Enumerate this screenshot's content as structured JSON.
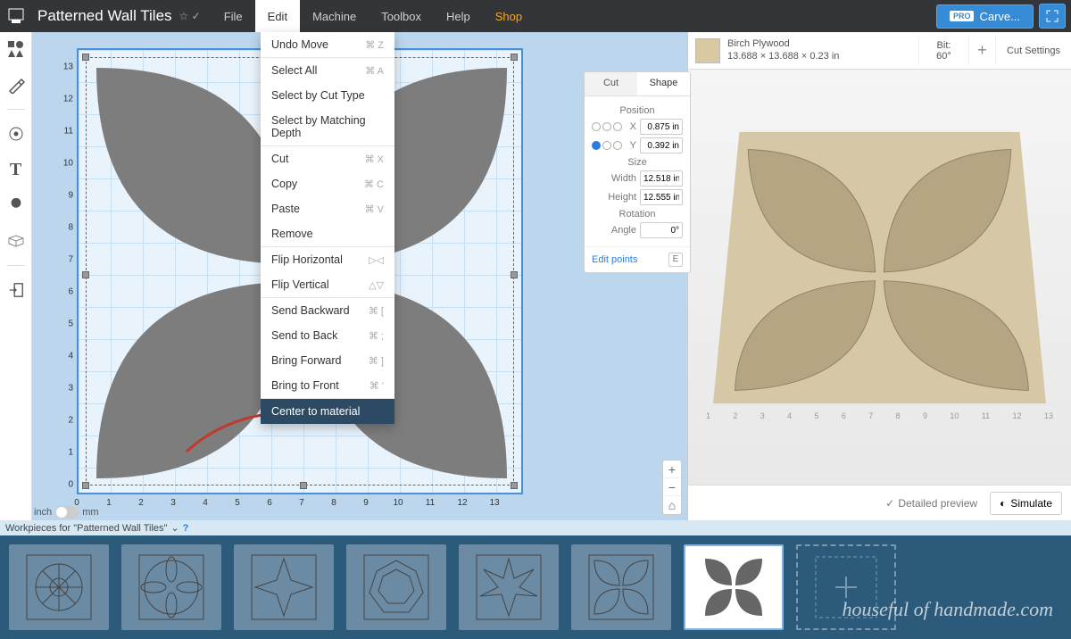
{
  "app": {
    "title": "Patterned Wall Tiles"
  },
  "menu": {
    "file": "File",
    "edit": "Edit",
    "machine": "Machine",
    "toolbox": "Toolbox",
    "help": "Help",
    "shop": "Shop"
  },
  "carve": {
    "pro": "PRO",
    "label": "Carve..."
  },
  "edit_menu": {
    "undo": "Undo Move",
    "undo_sc": "⌘ Z",
    "select_all": "Select All",
    "select_all_sc": "⌘ A",
    "select_cut": "Select by Cut Type",
    "select_depth": "Select by Matching Depth",
    "cut": "Cut",
    "cut_sc": "⌘ X",
    "copy": "Copy",
    "copy_sc": "⌘ C",
    "paste": "Paste",
    "paste_sc": "⌘ V",
    "remove": "Remove",
    "flip_h": "Flip Horizontal",
    "flip_v": "Flip Vertical",
    "send_back": "Send Backward",
    "send_back_sc": "⌘ [",
    "to_back": "Send to Back",
    "to_back_sc": "⌘ ;",
    "bring_fwd": "Bring Forward",
    "bring_fwd_sc": "⌘ ]",
    "to_front": "Bring to Front",
    "to_front_sc": "⌘ '",
    "center": "Center to material"
  },
  "shape_panel": {
    "tab_cut": "Cut",
    "tab_shape": "Shape",
    "position": "Position",
    "x_lbl": "X",
    "x_val": "0.875 in",
    "y_lbl": "Y",
    "y_val": "0.392 in",
    "size": "Size",
    "w_lbl": "Width",
    "w_val": "12.518 in",
    "h_lbl": "Height",
    "h_val": "12.555 in",
    "rotation": "Rotation",
    "a_lbl": "Angle",
    "a_val": "0°",
    "edit_points": "Edit points",
    "edit_key": "E"
  },
  "units": {
    "inch": "inch",
    "mm": "mm"
  },
  "ruler": {
    "y": [
      "0",
      "1",
      "2",
      "3",
      "4",
      "5",
      "6",
      "7",
      "8",
      "9",
      "10",
      "11",
      "12",
      "13"
    ],
    "x": [
      "0",
      "1",
      "2",
      "3",
      "4",
      "5",
      "6",
      "7",
      "8",
      "9",
      "10",
      "11",
      "12",
      "13"
    ]
  },
  "preview": {
    "material_name": "Birch Plywood",
    "material_dims": "13.688 × 13.688 × 0.23 in",
    "bit_lbl": "Bit:",
    "bit_val": "60°",
    "cut_settings": "Cut Settings",
    "detailed": "Detailed preview",
    "simulate": "Simulate",
    "ruler": [
      "1",
      "2",
      "3",
      "4",
      "5",
      "6",
      "7",
      "8",
      "9",
      "10",
      "11",
      "12",
      "13"
    ]
  },
  "workpieces": {
    "header": "Workpieces for \"Patterned Wall Tiles\""
  },
  "watermark": "houseful of handmade.com"
}
